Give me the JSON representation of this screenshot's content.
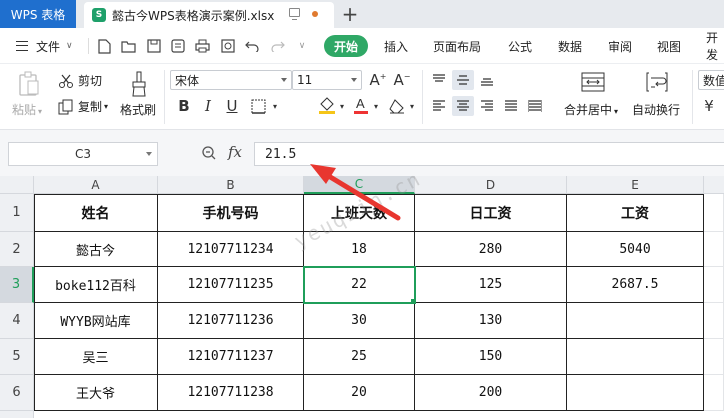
{
  "titlebar": {
    "app_tab": "WPS 表格",
    "doc_tab": "懿古今WPS表格演示案例.xlsx",
    "doc_icon_letter": "S",
    "new_tab": "+"
  },
  "menu": {
    "file": "文件",
    "items": [
      "开始",
      "插入",
      "页面布局",
      "公式",
      "数据",
      "审阅",
      "视图",
      "开发"
    ]
  },
  "ribbon": {
    "paste": "粘贴",
    "cut": "剪切",
    "copy": "复制",
    "format_painter": "格式刷",
    "font_name": "宋体",
    "font_size": "11",
    "merge_center": "合并居中",
    "wrap_text": "自动换行",
    "number_format": "数值"
  },
  "formula_bar": {
    "name_box": "C3",
    "fx": "fx",
    "value": "21.5"
  },
  "grid": {
    "columns": [
      "A",
      "B",
      "C",
      "D",
      "E"
    ],
    "rows": [
      "1",
      "2",
      "3",
      "4",
      "5",
      "6"
    ],
    "headers": [
      "姓名",
      "手机号码",
      "上班天数",
      "日工资",
      "工资"
    ],
    "data": [
      [
        "懿古今",
        "12107711234",
        "18",
        "280",
        "5040"
      ],
      [
        "boke112百科",
        "12107711235",
        "22",
        "125",
        "2687.5"
      ],
      [
        "WYYB网站库",
        "12107711236",
        "30",
        "130",
        ""
      ],
      [
        "吴三",
        "12107711237",
        "25",
        "150",
        ""
      ],
      [
        "王大爷",
        "12107711238",
        "20",
        "200",
        ""
      ]
    ],
    "selected_cell": "C3"
  },
  "watermark": "yeuqiin.cn",
  "colors": {
    "accent_green": "#1f9e5a",
    "wps_blue": "#1f6fce",
    "arrow_red": "#e8362f"
  }
}
